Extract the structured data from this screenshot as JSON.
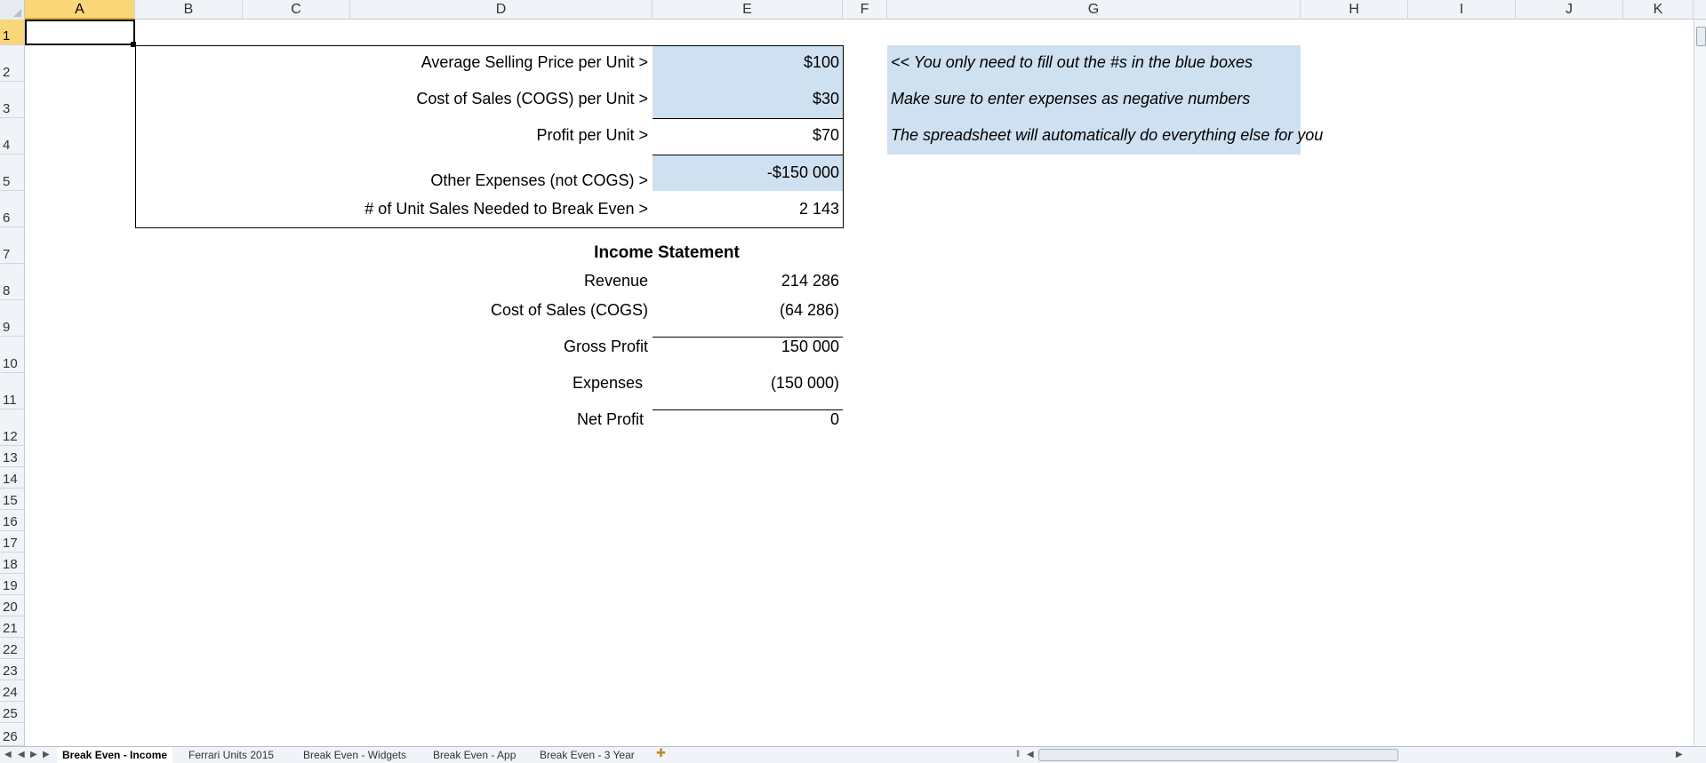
{
  "columns": [
    "A",
    "B",
    "C",
    "D",
    "E",
    "F",
    "G",
    "H",
    "I",
    "J",
    "K"
  ],
  "rows": [
    "1",
    "2",
    "3",
    "4",
    "5",
    "6",
    "7",
    "8",
    "9",
    "10",
    "11",
    "12",
    "13",
    "14",
    "15",
    "16",
    "17",
    "18",
    "19",
    "20",
    "21",
    "22",
    "23",
    "24",
    "25",
    "26"
  ],
  "inputs": {
    "avg_price_label": "Average Selling Price per Unit >",
    "avg_price_value": "$100",
    "cogs_label": "Cost of Sales (COGS) per Unit >",
    "cogs_value": "$30",
    "profit_label": "Profit per Unit >",
    "profit_value": "$70",
    "other_exp_label": "Other Expenses (not COGS) >",
    "other_exp_value": "-$150 000",
    "break_even_label": "# of Unit Sales Needed to Break Even >",
    "break_even_value": "2 143"
  },
  "notes": {
    "note1": "<< You only need to fill out the #s in the blue boxes",
    "note2": "Make sure to enter expenses as negative numbers",
    "note3": "The spreadsheet will automatically do everything else for you"
  },
  "income_statement": {
    "title": "Income Statement",
    "revenue_label": "Revenue",
    "revenue_value": "214 286",
    "cogs_label": "Cost of Sales (COGS)",
    "cogs_value": "(64 286)",
    "gross_label": "Gross Profit",
    "gross_value": "150 000",
    "expenses_label": "Expenses",
    "expenses_value": "(150 000)",
    "net_label": "Net Profit",
    "net_value": "0"
  },
  "sheet_tabs": [
    "Break Even - Income",
    "Ferrari Units 2015",
    "Break Even - Widgets",
    "Break Even - App",
    "Break Even - 3 Year"
  ],
  "colors": {
    "input_fill": "#cfe0f1",
    "header_bg": "#f0f3f7",
    "selected_header": "#f9d677"
  }
}
